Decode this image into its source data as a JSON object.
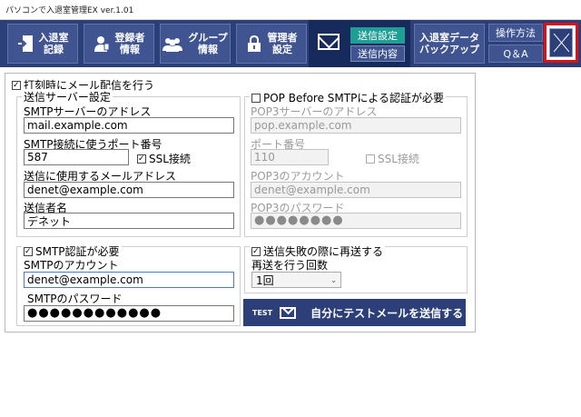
{
  "window": {
    "title": "パソコンで入退室管理EX ver.1.01"
  },
  "toolbar": {
    "entry_record": {
      "line1": "入退室",
      "line2": "記録"
    },
    "registrant": {
      "line1": "登録者",
      "line2": "情報"
    },
    "group": {
      "line1": "グループ",
      "line2": "情報"
    },
    "admin": {
      "line1": "管理者",
      "line2": "設定"
    },
    "send_settings": "送信設定",
    "send_content": "送信内容",
    "backup": {
      "line1": "入退室データ",
      "line2": "バックアップ"
    },
    "howto": "操作方法",
    "qa": "Q＆A"
  },
  "form": {
    "mail_on_stamp": {
      "label": "打刻時にメール配信を行う",
      "checked": true
    },
    "send_server": {
      "group_label": "送信サーバー設定",
      "smtp_address_label": "SMTPサーバーのアドレス",
      "smtp_address_value": "mail.example.com",
      "port_label": "SMTP接続に使うポート番号",
      "port_value": "587",
      "ssl_label": "SSL接続",
      "ssl_checked": true,
      "from_address_label": "送信に使用するメールアドレス",
      "from_address_value": "denet@example.com",
      "sender_name_label": "送信者名",
      "sender_name_value": "デネット"
    },
    "pop": {
      "label": "POP Before SMTPによる認証が必要",
      "checked": false,
      "pop3_address_label": "POP3サーバーのアドレス",
      "pop3_address_value": "pop.example.com",
      "port_label": "ポート番号",
      "port_value": "110",
      "ssl_label": "SSL接続",
      "ssl_checked": false,
      "account_label": "POP3のアカウント",
      "account_value": "denet@example.com",
      "password_label": "POP3のパスワード",
      "password_value": "●●●●●●●●"
    },
    "smtp_auth": {
      "label": "SMTP認証が必要",
      "checked": true,
      "account_label": "SMTPのアカウント",
      "account_value": "denet@example.com",
      "password_label": "SMTPのパスワード",
      "password_value": "●●●●●●●●●●●●"
    },
    "retry": {
      "label": "送信失敗の際に再送する",
      "checked": true,
      "count_label": "再送を行う回数",
      "count_value": "1回"
    },
    "test_button": {
      "prefix": "TEST",
      "label": "自分にテストメールを送信する"
    }
  },
  "colors": {
    "toolbar_bg": "#2c3f78",
    "button_bg": "#3f5490",
    "active_tab": "#1f9e95",
    "close_highlight": "#e01010"
  }
}
